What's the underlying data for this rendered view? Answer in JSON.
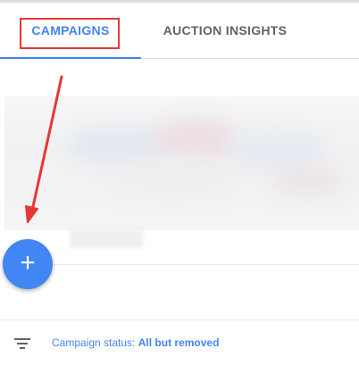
{
  "tabs": {
    "campaigns_label": "CAMPAIGNS",
    "auction_insights_label": "AUCTION INSIGHTS",
    "active_color": "#4285f4",
    "inactive_color": "#5f6368"
  },
  "annotation": {
    "highlight_color": "#e53935",
    "arrow_color": "#e53935"
  },
  "fab": {
    "icon": "plus-icon",
    "symbol": "+",
    "color": "#4285f4"
  },
  "filter": {
    "icon": "filter-icon",
    "label": "Campaign status:",
    "value": "All but removed"
  }
}
